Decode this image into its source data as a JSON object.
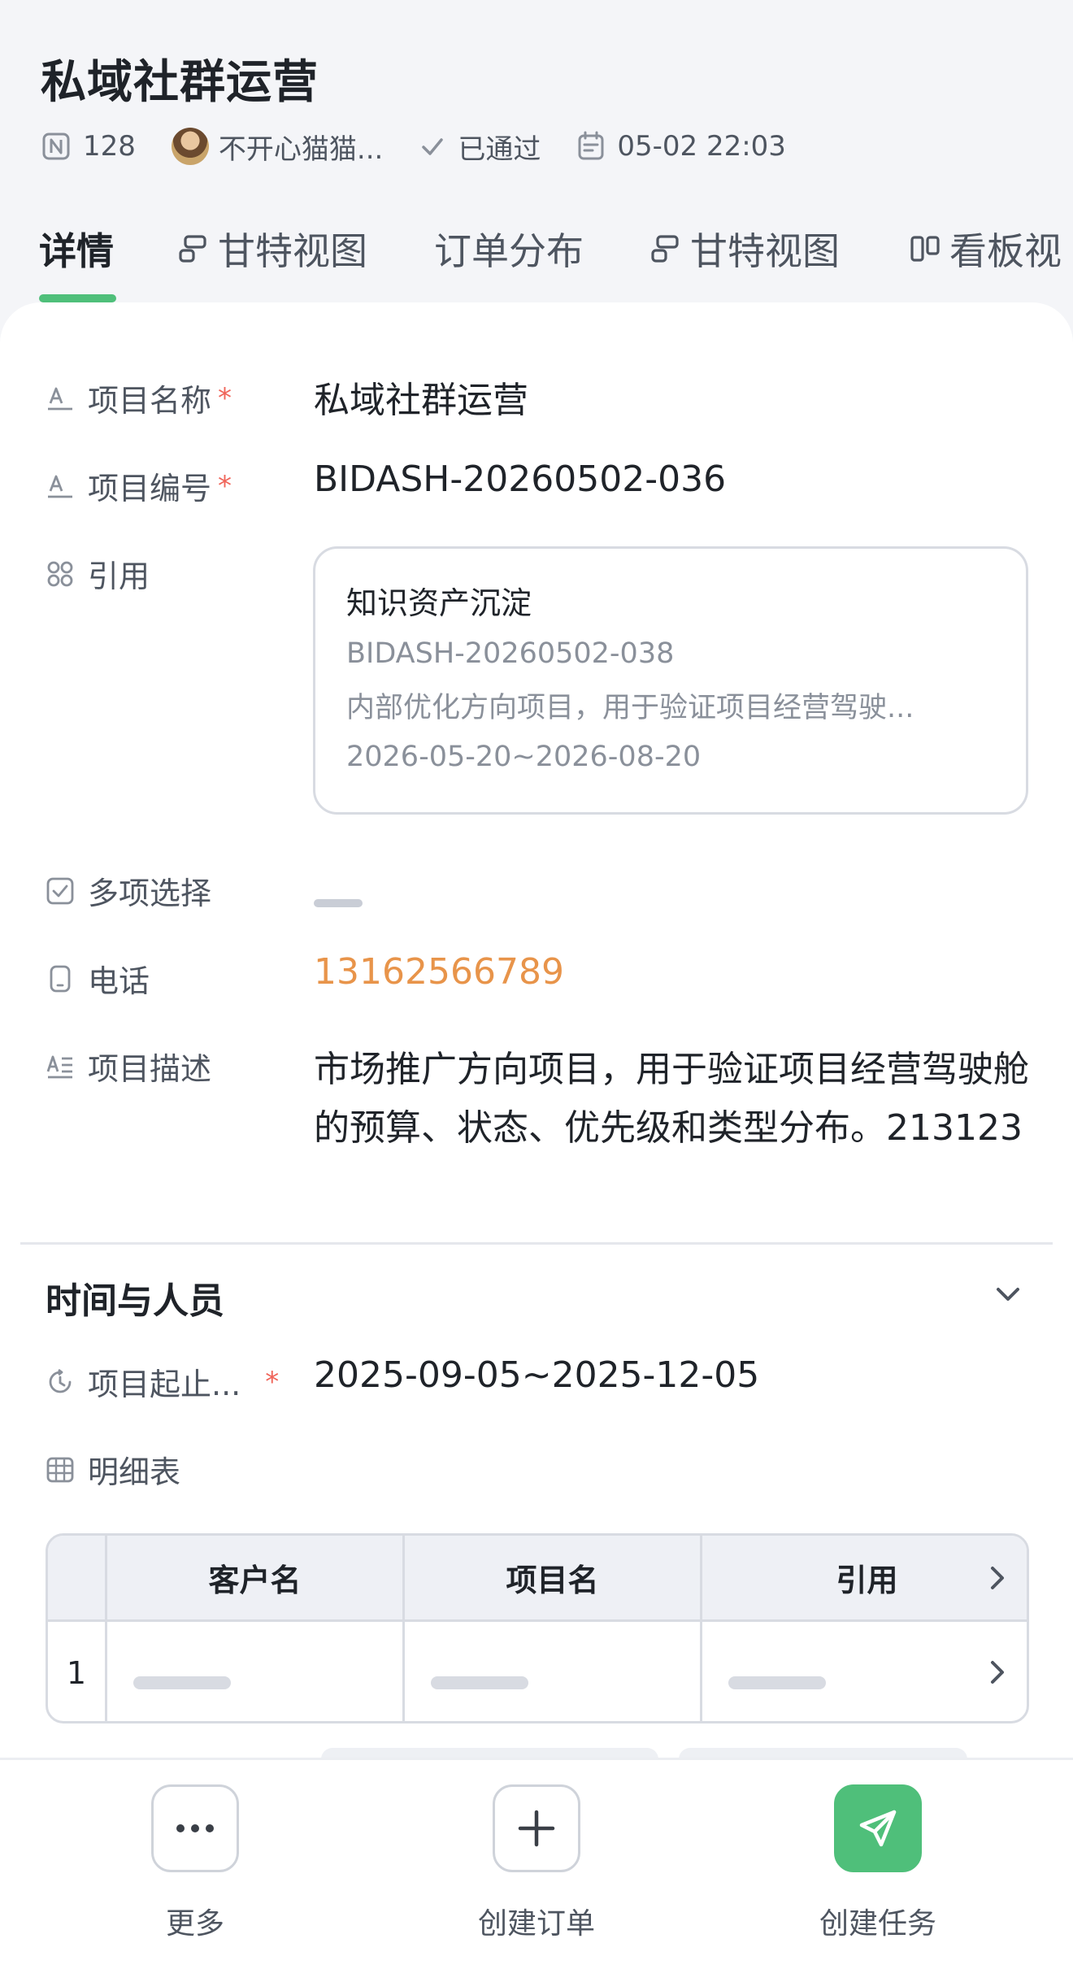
{
  "header": {
    "title": "私域社群运营",
    "meta": {
      "count": "128",
      "user": "不开心猫猫...",
      "status": "已通过",
      "datetime": "05-02 22:03"
    },
    "tabs": [
      {
        "label": "详情",
        "icon": "none",
        "active": true
      },
      {
        "label": "甘特视图",
        "icon": "gantt-icon",
        "active": false
      },
      {
        "label": "订单分布",
        "icon": "none",
        "active": false
      },
      {
        "label": "甘特视图",
        "icon": "gantt-icon",
        "active": false
      },
      {
        "label": "看板视",
        "icon": "kanban-icon",
        "active": false
      }
    ]
  },
  "fields": {
    "project_name": {
      "label": "项目名称",
      "required": "*",
      "value": "私域社群运营"
    },
    "project_code": {
      "label": "项目编号",
      "required": "*",
      "value": "BIDASH-20260502-036"
    },
    "reference": {
      "label": "引用",
      "card": {
        "title": "知识资产沉淀",
        "code": "BIDASH-20260502-038",
        "desc": "内部优化方向项目，用于验证项目经营驾驶...",
        "range": "2026-05-20~2026-08-20"
      }
    },
    "multi_select": {
      "label": "多项选择",
      "value": ""
    },
    "phone": {
      "label": "电话",
      "value": "13162566789"
    },
    "description": {
      "label": "项目描述",
      "value": "市场推广方向项目，用于验证项目经营驾驶舱的预算、状态、优先级和类型分布。213123"
    }
  },
  "section": {
    "title": "时间与人员",
    "period": {
      "label": "项目起止...",
      "required": "*",
      "value": "2025-09-05~2025-12-05"
    },
    "detail_table": {
      "label": "明细表",
      "columns": [
        "客户名",
        "项目名",
        "引用"
      ],
      "rows": [
        {
          "index": "1"
        }
      ]
    }
  },
  "bottom_bar": {
    "more": "更多",
    "create_order": "创建订单",
    "create_task": "创建任务"
  },
  "colors": {
    "accent": "#4fbf7a",
    "phone": "#e8944a",
    "required": "#f0655a"
  }
}
